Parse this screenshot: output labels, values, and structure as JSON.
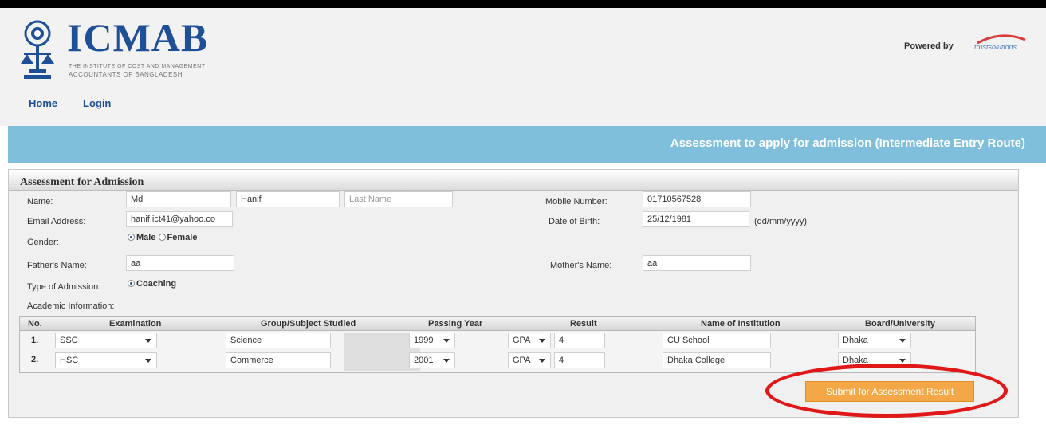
{
  "header": {
    "logo_title": "ICMAB",
    "logo_sub1": "THE INSTITUTE OF COST AND MANAGEMENT",
    "logo_sub2": "ACCOUNTANTS OF BANGLADESH",
    "powered_by": "Powered by",
    "powered_logo_text": "trustsolutions"
  },
  "nav": {
    "home": "Home",
    "login": "Login"
  },
  "banner": {
    "title": "Assessment to apply for admission (Intermediate Entry Route)"
  },
  "form": {
    "title": "Assessment for Admission",
    "name_label": "Name:",
    "first_name": "Md",
    "middle_name": "Hanif",
    "last_name_placeholder": "Last Name",
    "mobile_label": "Mobile Number:",
    "mobile_value": "01710567528",
    "email_label": "Email Address:",
    "email_value": "hanif.ict41@yahoo.co",
    "dob_label": "Date of Birth:",
    "dob_value": "25/12/1981",
    "dob_hint": "(dd/mm/yyyy)",
    "gender_label": "Gender:",
    "gender_male": "Male",
    "gender_female": "Female",
    "father_label": "Father's Name:",
    "father_value": "aa",
    "mother_label": "Mother's Name:",
    "mother_value": "aa",
    "admission_type_label": "Type of Admission:",
    "admission_type_value": "Coaching",
    "academic_label": "Academic Information:",
    "submit_label": "Submit for Assessment Result"
  },
  "academic": {
    "headers": [
      "No.",
      "Examination",
      "Group/Subject Studied",
      "Passing Year",
      "Result",
      "Name of Institution",
      "Board/University"
    ],
    "rows": [
      {
        "no": "1.",
        "exam": "SSC",
        "group": "Science",
        "year": "1999",
        "result_type": "GPA",
        "result": "4",
        "institution": "CU School",
        "board": "Dhaka"
      },
      {
        "no": "2.",
        "exam": "HSC",
        "group": "Commerce",
        "year": "2001",
        "result_type": "GPA",
        "result": "4",
        "institution": "Dhaka College",
        "board": "Dhaka"
      }
    ]
  },
  "colors": {
    "brand": "#1f4f96",
    "banner": "#7fbfdc",
    "submit": "#f3a747",
    "highlight": "#e01818"
  }
}
